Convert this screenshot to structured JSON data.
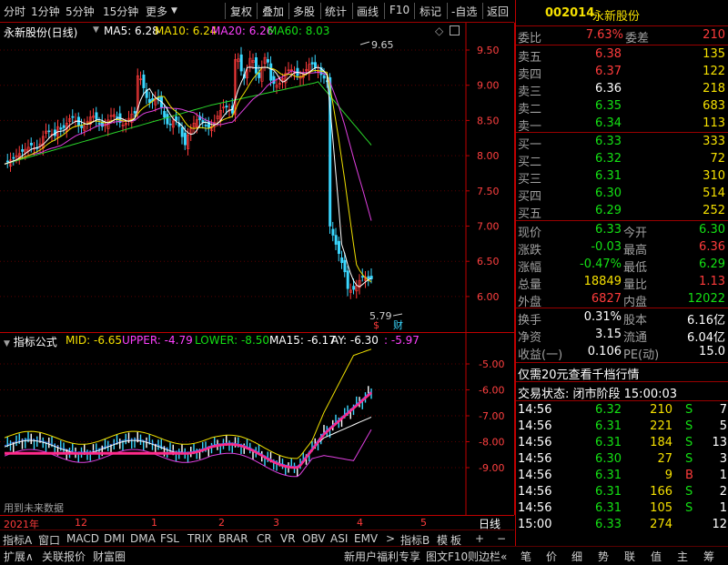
{
  "toolbar": {
    "items": [
      "分时",
      "1分钟",
      "5分钟",
      "15分钟",
      "更多",
      "复权",
      "叠加",
      "多股",
      "统计",
      "画线",
      "F10",
      "标记",
      "-自选",
      "返回"
    ]
  },
  "header": {
    "stock_name": "永新股份(日线)",
    "ma5": "MA5: 6.28",
    "ma10": "MA10: 6.24",
    "ma20": "MA20: 6.26",
    "ma60": "MA60: 8.03"
  },
  "main_chart": {
    "y_ticks": [
      "9.50",
      "9.00",
      "8.50",
      "8.00",
      "7.50",
      "7.00",
      "6.50",
      "6.00"
    ],
    "high_label": "9.65",
    "low_label": "5.79",
    "marker_s": "$",
    "marker_cai": "财"
  },
  "indicator": {
    "title": "指标公式",
    "mid": "MID: -6.65",
    "upper": "UPPER: -4.79",
    "lower": "LOWER: -8.50",
    "ma15": "MA15: -6.17",
    "ay": "AY: -6.30",
    "extra": ": -5.97",
    "y_ticks": [
      "-5.00",
      "-6.00",
      "-7.00",
      "-8.00",
      "-9.00"
    ],
    "note": "用到未来数据"
  },
  "xaxis": {
    "labels": [
      "2021年",
      "12",
      "1",
      "2",
      "3",
      "4",
      "5"
    ],
    "period": "日线"
  },
  "tabs1": [
    "指标A",
    "窗口",
    "MACD",
    "DMI",
    "DMA",
    "FSL",
    "TRIX",
    "BRAR",
    "CR",
    "VR",
    "OBV",
    "ASI",
    "EMV",
    ">",
    "指标B",
    "模",
    "板",
    "+",
    "−"
  ],
  "tabs2": [
    "扩展∧",
    "关联报价",
    "财富圈",
    "新用户福利专享",
    "图文F10",
    "则边栏«",
    "笔",
    "价",
    "细",
    "势",
    "联",
    "值",
    "主",
    "筹"
  ],
  "quote": {
    "code": "002014",
    "name": "永新股份",
    "weibi_label": "委比",
    "weibi": "7.63%",
    "weicha_label": "委差",
    "weicha": "210",
    "asks": [
      {
        "label": "卖五",
        "price": "6.38",
        "vol": "135"
      },
      {
        "label": "卖四",
        "price": "6.37",
        "vol": "122"
      },
      {
        "label": "卖三",
        "price": "6.36",
        "vol": "218"
      },
      {
        "label": "卖二",
        "price": "6.35",
        "vol": "683"
      },
      {
        "label": "卖一",
        "price": "6.34",
        "vol": "113"
      }
    ],
    "bids": [
      {
        "label": "买一",
        "price": "6.33",
        "vol": "333"
      },
      {
        "label": "买二",
        "price": "6.32",
        "vol": "72"
      },
      {
        "label": "买三",
        "price": "6.31",
        "vol": "310"
      },
      {
        "label": "买四",
        "price": "6.30",
        "vol": "514"
      },
      {
        "label": "买五",
        "price": "6.29",
        "vol": "252"
      }
    ],
    "stats": [
      {
        "l1": "现价",
        "v1": "6.33",
        "l2": "今开",
        "v2": "6.30"
      },
      {
        "l1": "涨跌",
        "v1": "-0.03",
        "l2": "最高",
        "v2": "6.36"
      },
      {
        "l1": "涨幅",
        "v1": "-0.47%",
        "l2": "最低",
        "v2": "6.29"
      },
      {
        "l1": "总量",
        "v1": "18849",
        "l2": "量比",
        "v2": "1.13"
      },
      {
        "l1": "外盘",
        "v1": "6827",
        "l2": "内盘",
        "v2": "12022"
      }
    ],
    "stats2": [
      {
        "l1": "换手",
        "v1": "0.31%",
        "l2": "股本",
        "v2": "6.16亿"
      },
      {
        "l1": "净资",
        "v1": "3.15",
        "l2": "流通",
        "v2": "6.04亿"
      },
      {
        "l1": "收益(一)",
        "v1": "0.106",
        "l2": "PE(动)",
        "v2": "15.0"
      }
    ],
    "promo": "仅需20元查看千档行情",
    "status": "交易状态: 闭市阶段 15:00:03",
    "trades": [
      {
        "t": "14:56",
        "p": "6.32",
        "v": "210",
        "d": "S",
        "n": "7"
      },
      {
        "t": "14:56",
        "p": "6.31",
        "v": "221",
        "d": "S",
        "n": "5"
      },
      {
        "t": "14:56",
        "p": "6.31",
        "v": "184",
        "d": "S",
        "n": "13"
      },
      {
        "t": "14:56",
        "p": "6.30",
        "v": "27",
        "d": "S",
        "n": "3"
      },
      {
        "t": "14:56",
        "p": "6.31",
        "v": "9",
        "d": "B",
        "n": "1"
      },
      {
        "t": "14:56",
        "p": "6.31",
        "v": "166",
        "d": "S",
        "n": "2"
      },
      {
        "t": "14:56",
        "p": "6.31",
        "v": "105",
        "d": "S",
        "n": "1"
      },
      {
        "t": "15:00",
        "p": "6.33",
        "v": "274",
        "d": "",
        "n": "12"
      }
    ]
  }
}
